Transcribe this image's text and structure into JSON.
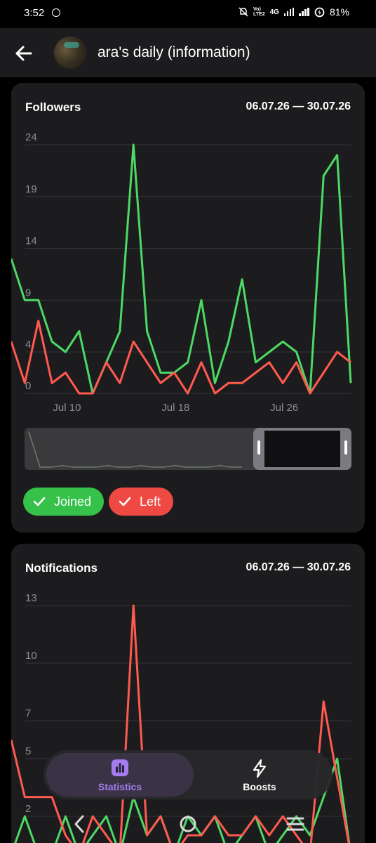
{
  "status_bar": {
    "time": "3:52",
    "network_top": "Vo)",
    "network_bottom": "LTE2",
    "network_type": "4G",
    "battery": "81%"
  },
  "header": {
    "title": "ara's daily (information)"
  },
  "followers_card": {
    "title": "Followers",
    "date_range": "06.07.26 — 30.07.26"
  },
  "notifications_card": {
    "title": "Notifications",
    "date_range": "06.07.26 — 30.07.26"
  },
  "legend": {
    "joined": "Joined",
    "left": "Left"
  },
  "bottom_nav": {
    "statistics": "Statistics",
    "boosts": "Boosts"
  },
  "colors": {
    "joined": "#4cd964",
    "left": "#ff5a4f",
    "accent": "#a47cf0"
  },
  "icons": [
    "back-arrow-icon",
    "statistics-icon",
    "boosts-icon",
    "check-icon",
    "nav-back-icon",
    "nav-home-icon",
    "nav-recents-icon"
  ],
  "chart_data": [
    {
      "type": "line",
      "title": "Followers",
      "x_tick_labels": [
        "Jul 10",
        "Jul 18",
        "Jul 26"
      ],
      "y_tick_labels": [
        "0",
        "4",
        "9",
        "14",
        "19",
        "24"
      ],
      "ylim": [
        0,
        24
      ],
      "x": [
        "Jul 6",
        "Jul 7",
        "Jul 8",
        "Jul 9",
        "Jul 10",
        "Jul 11",
        "Jul 12",
        "Jul 13",
        "Jul 14",
        "Jul 15",
        "Jul 16",
        "Jul 17",
        "Jul 18",
        "Jul 19",
        "Jul 20",
        "Jul 21",
        "Jul 22",
        "Jul 23",
        "Jul 24",
        "Jul 25",
        "Jul 26",
        "Jul 27",
        "Jul 28",
        "Jul 29",
        "Jul 30"
      ],
      "series": [
        {
          "name": "Joined",
          "values": [
            13,
            9,
            9,
            5,
            4,
            6,
            0,
            3,
            6,
            24,
            6,
            2,
            2,
            3,
            9,
            1,
            5,
            11,
            3,
            4,
            5,
            4,
            0,
            21,
            23,
            1
          ]
        },
        {
          "name": "Left",
          "values": [
            5,
            1,
            7,
            1,
            2,
            0,
            0,
            3,
            1,
            5,
            3,
            1,
            2,
            0,
            3,
            0,
            1,
            1,
            2,
            3,
            1,
            3,
            0,
            2,
            4,
            3
          ]
        }
      ]
    },
    {
      "type": "line",
      "title": "Notifications",
      "y_tick_labels": [
        "2",
        "5",
        "7",
        "10",
        "13"
      ],
      "ylim": [
        2,
        13
      ],
      "series": [
        {
          "name": "Joined",
          "values": [
            0,
            2,
            0,
            0,
            2,
            0,
            1,
            2,
            0,
            3,
            1,
            2,
            0,
            2,
            1,
            2,
            0,
            1,
            2,
            0,
            1,
            2,
            1,
            3,
            5,
            0
          ]
        },
        {
          "name": "Left",
          "values": [
            6,
            3,
            3,
            3,
            1,
            0,
            2,
            1,
            0,
            13,
            1,
            2,
            0,
            1,
            1,
            2,
            1,
            1,
            2,
            1,
            2,
            1,
            0,
            8,
            4,
            0
          ]
        }
      ]
    }
  ]
}
